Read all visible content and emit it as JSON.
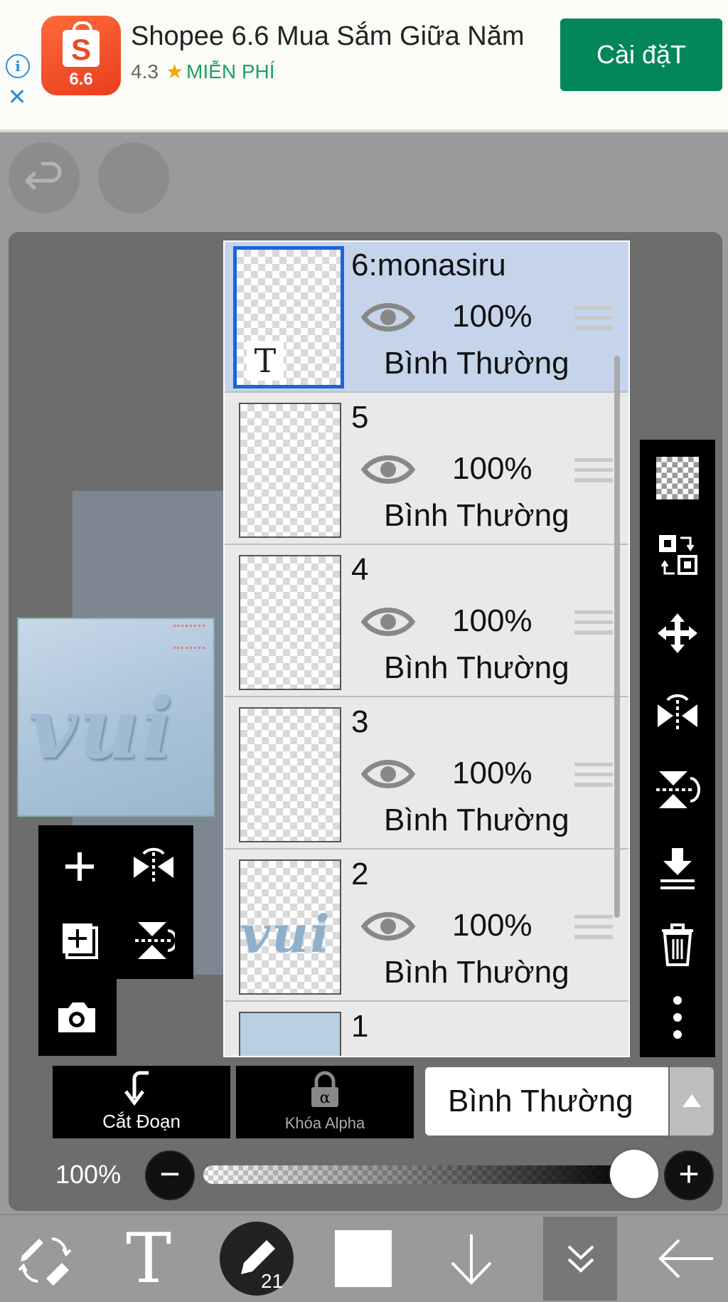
{
  "ad": {
    "title": "Shopee 6.6 Mua Sắm Giữa Năm",
    "rating": "4.3",
    "price": "MIỄN PHÍ",
    "install_label": "Cài đặT",
    "logo_text": "6.6",
    "logo_letter": "S"
  },
  "canvas": {
    "preview_text": "vui"
  },
  "layers": [
    {
      "name": "6:monasiru",
      "opacity": "100%",
      "blend": "Bình Thường",
      "selected": true
    },
    {
      "name": "5",
      "opacity": "100%",
      "blend": "Bình Thường"
    },
    {
      "name": "4",
      "opacity": "100%",
      "blend": "Bình Thường"
    },
    {
      "name": "3",
      "opacity": "100%",
      "blend": "Bình Thường"
    },
    {
      "name": "2",
      "opacity": "100%",
      "blend": "Bình Thường",
      "thumb_text": "vui"
    },
    {
      "name": "1"
    }
  ],
  "controls": {
    "clip_label": "Cắt Đoạn",
    "alpha_lock_label": "Khóa Alpha",
    "blend_mode": "Bình Thường",
    "opacity_label": "100%",
    "opacity_value": 1.0
  },
  "bottom_nav": {
    "text_tool": "T",
    "brush_size": "21"
  },
  "colors": {
    "accent": "#1a66d9",
    "install_green": "#03875a",
    "selected_layer": "#c5d4ea"
  }
}
